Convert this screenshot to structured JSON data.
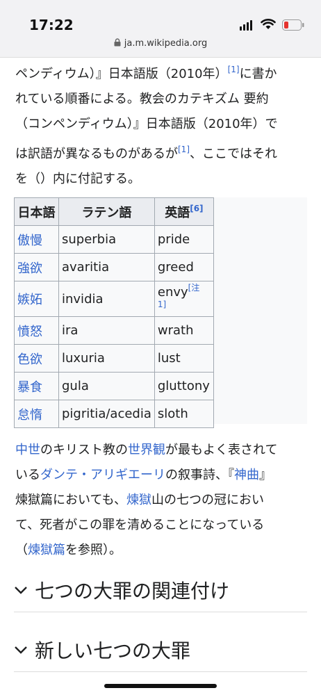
{
  "status": {
    "time": "17:22",
    "url": "ja.m.wikipedia.org"
  },
  "intro": {
    "line1_a": "ペンディウム）』日本語版（2010年）",
    "line1_ref": "[1]",
    "line1_b": "に書か",
    "line2": "れている順番による。教会のカテキズム 要約",
    "line3": "（コンペンディウム）』日本語版（2010年）で",
    "line4_a": "は訳語が異なるものがあるが",
    "line4_ref": "[1]",
    "line4_b": "、ここではそれ",
    "line5": "を（）内に付記する。"
  },
  "table": {
    "headers": {
      "ja": "日本語",
      "la": "ラテン語",
      "en": "英語",
      "en_ref": "[6]"
    },
    "rows": [
      {
        "ja": "傲慢",
        "la": "superbia",
        "en": "pride",
        "note": ""
      },
      {
        "ja": "強欲",
        "la": "avaritia",
        "en": "greed",
        "note": ""
      },
      {
        "ja": "嫉妬",
        "la": "invidia",
        "en": "envy",
        "note": "[注 1]"
      },
      {
        "ja": "憤怒",
        "la": "ira",
        "en": "wrath",
        "note": ""
      },
      {
        "ja": "色欲",
        "la": "luxuria",
        "en": "lust",
        "note": ""
      },
      {
        "ja": "暴食",
        "la": "gula",
        "en": "gluttony",
        "note": ""
      },
      {
        "ja": "怠惰",
        "la": "pigritia/acedia",
        "en": "sloth",
        "note": ""
      }
    ]
  },
  "para2": {
    "l1_link1": "中世",
    "l1_t1": "のキリスト教の",
    "l1_link2": "世界観",
    "l1_t2": "が最もよく表されて",
    "l2_t1": "いる",
    "l2_link": "ダンテ・アリギエーリ",
    "l2_t2": "の叙事詩、『",
    "l2_link2": "神曲",
    "l2_t3": "』",
    "l3_t1": "煉獄篇においても、",
    "l3_link": "煉獄",
    "l3_t2": "山の七つの冠におい",
    "l4": "て、死者がこの罪を清めることになっている",
    "l5_t1": "（",
    "l5_link": "煉獄篇",
    "l5_t2": "を参照）。"
  },
  "sections": [
    {
      "title": "七つの大罪の関連付け"
    },
    {
      "title": "新しい七つの大罪"
    }
  ]
}
